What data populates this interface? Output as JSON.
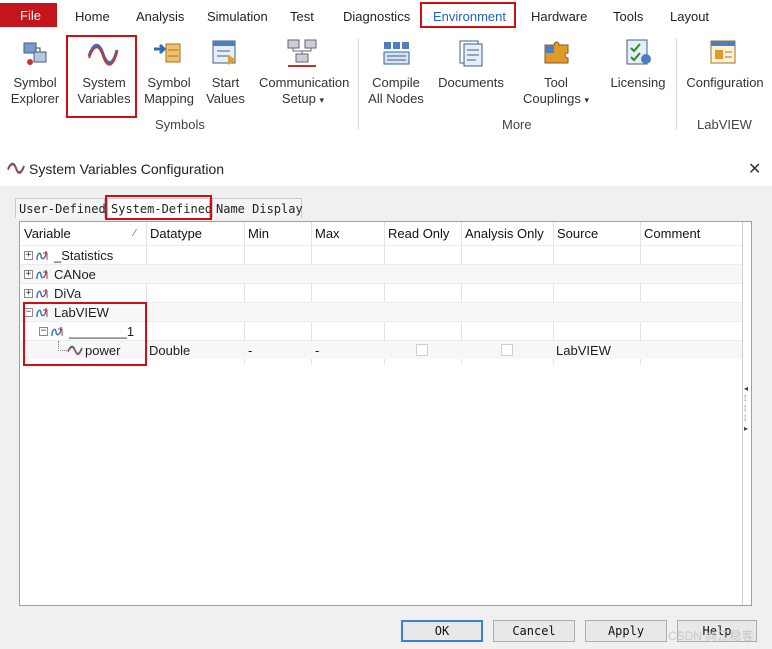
{
  "menu": {
    "file": "File",
    "items": [
      "Home",
      "Analysis",
      "Simulation",
      "Test",
      "Diagnostics",
      "Environment",
      "Hardware",
      "Tools",
      "Layout"
    ],
    "active": "Environment"
  },
  "ribbon": {
    "buttons": [
      {
        "line1": "Symbol",
        "line2": "Explorer",
        "icon": "symbol-explorer-icon"
      },
      {
        "line1": "System",
        "line2": "Variables",
        "icon": "sine-wave-icon"
      },
      {
        "line1": "Symbol",
        "line2": "Mapping",
        "icon": "mapping-icon"
      },
      {
        "line1": "Start",
        "line2": "Values",
        "icon": "start-values-icon"
      },
      {
        "line1": "Communication",
        "line2": "Setup",
        "icon": "network-icon",
        "dropdown": "▾"
      },
      {
        "line1": "Compile",
        "line2": "All Nodes",
        "icon": "compile-icon"
      },
      {
        "line1": "Documents",
        "line2": "",
        "icon": "documents-icon"
      },
      {
        "line1": "Tool",
        "line2": "Couplings",
        "icon": "puzzle-icon",
        "dropdown": "▾"
      },
      {
        "line1": "Licensing",
        "line2": "",
        "icon": "license-icon"
      },
      {
        "line1": "Configuration",
        "line2": "",
        "icon": "configuration-icon"
      }
    ],
    "groups": [
      "Symbols",
      "More",
      "LabVIEW"
    ]
  },
  "dialog": {
    "title": "System Variables Configuration",
    "close": "✕",
    "tabs": [
      "User-Defined",
      "System-Defined",
      "Name Display"
    ],
    "active_tab": "System-Defined",
    "columns": [
      "Variable",
      "Datatype",
      "Min",
      "Max",
      "Read Only",
      "Analysis Only",
      "Source",
      "Comment"
    ],
    "sort_indicator": "⁄",
    "rows": [
      {
        "name": "_Statistics",
        "expander": "+",
        "level": 0
      },
      {
        "name": "CANoe",
        "expander": "+",
        "level": 0
      },
      {
        "name": "DiVa",
        "expander": "+",
        "level": 0
      },
      {
        "name": "LabVIEW",
        "expander": "−",
        "level": 0
      },
      {
        "name": "________1",
        "expander": "−",
        "level": 1
      },
      {
        "name": "power",
        "level": 2,
        "datatype": "Double",
        "min": "-",
        "max": "-",
        "read_only": false,
        "analysis_only": false,
        "source": "LabVIEW",
        "comment": ""
      }
    ],
    "buttons": {
      "ok": "OK",
      "cancel": "Cancel",
      "apply": "Apply",
      "help": "Help"
    }
  },
  "watermark": "CSDN @江稳客",
  "colors": {
    "file_bg": "#c4141c",
    "highlight": "#d01010",
    "env_text": "#1e63d0",
    "dialog_bg": "#f0f0f0"
  }
}
